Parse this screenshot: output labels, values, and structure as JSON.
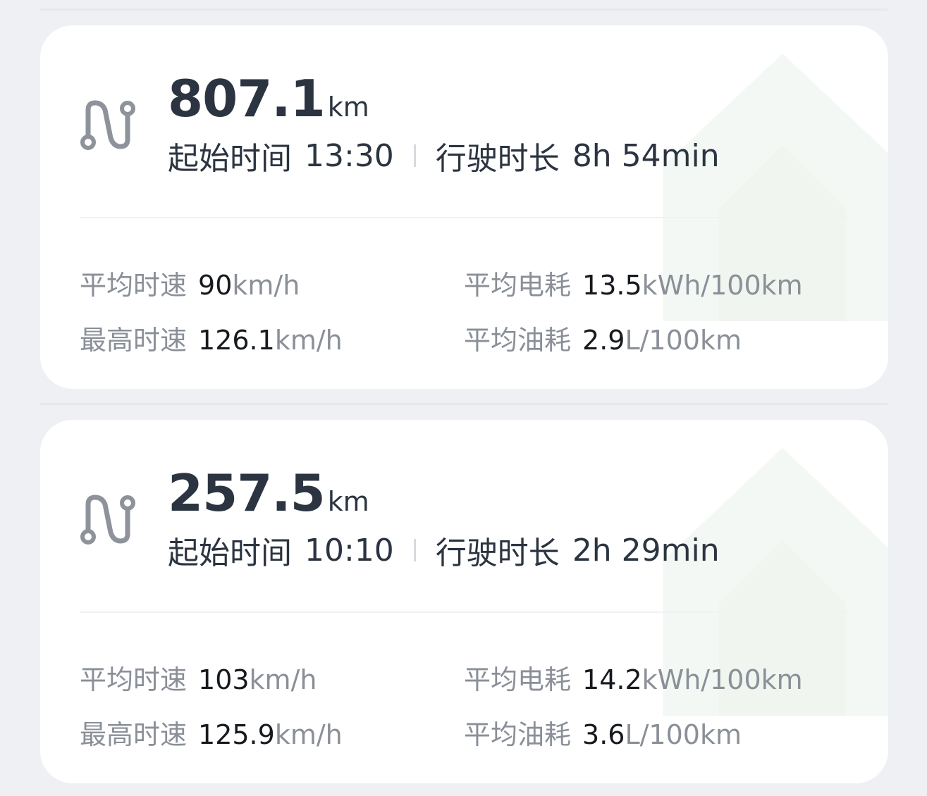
{
  "trips": [
    {
      "distance_value": "807.1",
      "distance_unit": "km",
      "start_label": "起始时间",
      "start_time": "13:30",
      "duration_label": "行驶时长",
      "duration": "8h 54min",
      "avg_speed_label": "平均时速",
      "avg_speed_value": "90",
      "avg_speed_unit": "km/h",
      "max_speed_label": "最高时速",
      "max_speed_value": "126.1",
      "max_speed_unit": "km/h",
      "avg_elec_label": "平均电耗",
      "avg_elec_value": "13.5",
      "avg_elec_unit": "kWh/100km",
      "avg_fuel_label": "平均油耗",
      "avg_fuel_value": "2.9",
      "avg_fuel_unit": "L/100km"
    },
    {
      "distance_value": "257.5",
      "distance_unit": "km",
      "start_label": "起始时间",
      "start_time": "10:10",
      "duration_label": "行驶时长",
      "duration": "2h 29min",
      "avg_speed_label": "平均时速",
      "avg_speed_value": "103",
      "avg_speed_unit": "km/h",
      "max_speed_label": "最高时速",
      "max_speed_value": "125.9",
      "max_speed_unit": "km/h",
      "avg_elec_label": "平均电耗",
      "avg_elec_value": "14.2",
      "avg_elec_unit": "kWh/100km",
      "avg_fuel_label": "平均油耗",
      "avg_fuel_value": "3.6",
      "avg_fuel_unit": "L/100km"
    }
  ],
  "icons": {
    "route": "route-icon",
    "watermark": "house-watermark-icon"
  },
  "colors": {
    "background": "#eef0f3",
    "card": "#ffffff",
    "primary_text": "#2b3440",
    "secondary_text": "#8a8f98",
    "value_text": "#16191d"
  }
}
